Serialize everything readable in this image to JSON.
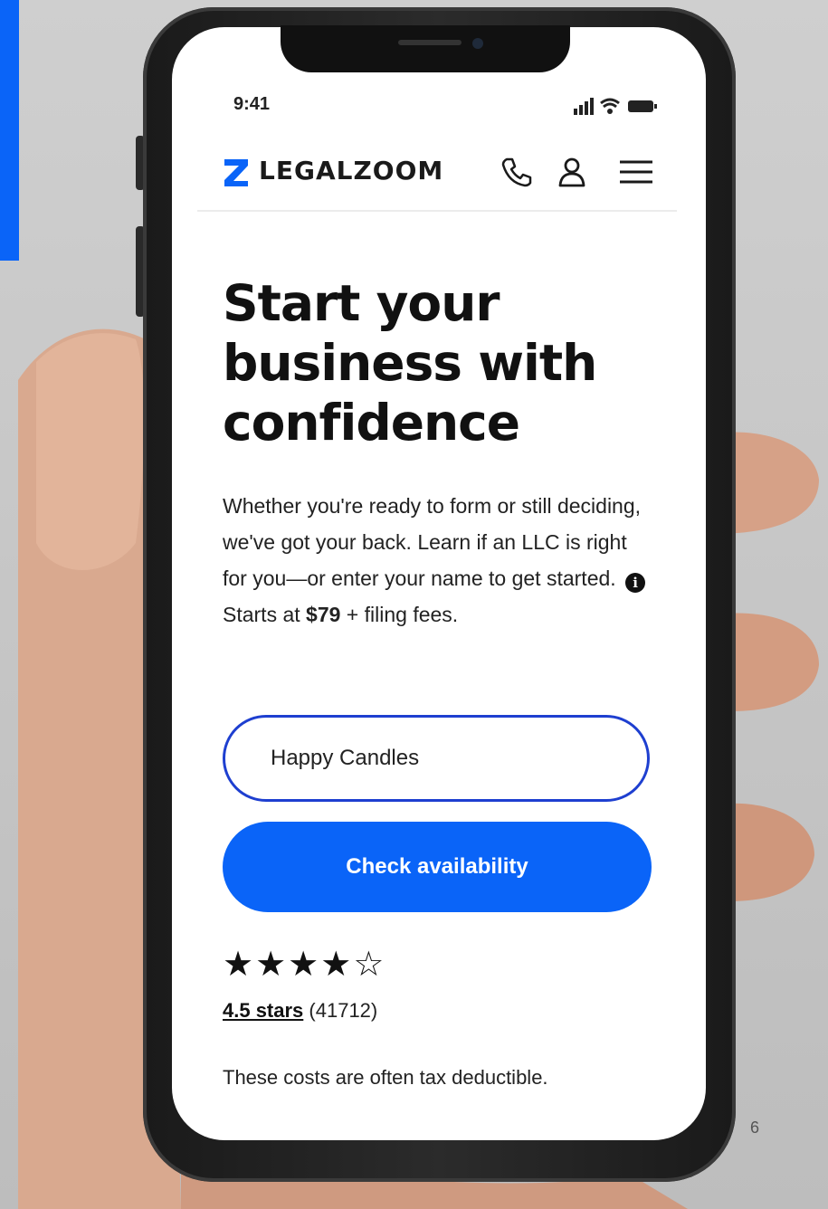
{
  "slide": {
    "page_number": "6",
    "accent_color": "#0a64f8"
  },
  "phone": {
    "status_bar": {
      "time": "9:41",
      "icons": [
        "signal-icon",
        "wifi-icon",
        "battery-icon"
      ]
    },
    "navbar": {
      "logo_text": "LEGALZOOM",
      "logo_color": "#0a64f8",
      "icons": [
        "phone-icon",
        "user-icon",
        "menu-icon"
      ]
    },
    "hero": {
      "headline": "Start your business with confidence",
      "description": "Whether you're ready to form or still deciding, we've got your back. Learn if an LLC is right for you—or enter your name to get started.",
      "info_icon": "i",
      "price_prefix": "Starts at ",
      "price": "$79",
      "price_suffix": " + filing fees."
    },
    "name_input": {
      "value": "Happy Candles",
      "border_color": "#1e3fd0"
    },
    "cta": {
      "label": "Check availability",
      "color": "#0a64f8"
    },
    "rating": {
      "stars": [
        "★",
        "★",
        "★",
        "★",
        "☆"
      ],
      "value_text": "4.5 stars",
      "count_text": " (41712)"
    },
    "footnote": "These costs are often tax deductible."
  }
}
